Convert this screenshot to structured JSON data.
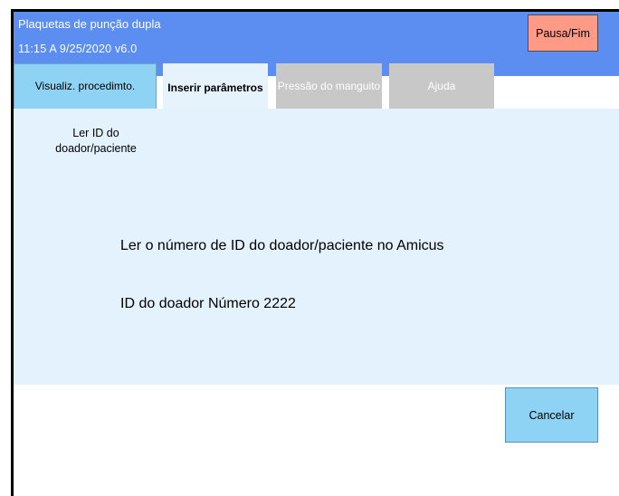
{
  "header": {
    "title": "Plaquetas de punção dupla",
    "status": "11:15 A  9/25/2020   v6.0",
    "pause_label": "Pausa/Fim"
  },
  "tabs": [
    {
      "label": "Visualiz. procedimto.",
      "state": "normal"
    },
    {
      "label": "Inserir parâmetros",
      "state": "active"
    },
    {
      "label": "Pressão do manguito",
      "state": "disabled"
    },
    {
      "label": "Ajuda",
      "state": "disabled"
    }
  ],
  "panel": {
    "title": "Ler ID do doador/paciente",
    "instruction": "Ler o número de ID do doador/paciente no Amicus",
    "donor_id": "ID do doador Número 2222"
  },
  "footer": {
    "cancel_label": "Cancelar"
  },
  "colors": {
    "header": "#5b8ef0",
    "pause_button": "#ff9a86",
    "active_tab": "#8fd3f4",
    "disabled_tab": "#c8c8c8",
    "content_bg": "#e3f2fd"
  }
}
